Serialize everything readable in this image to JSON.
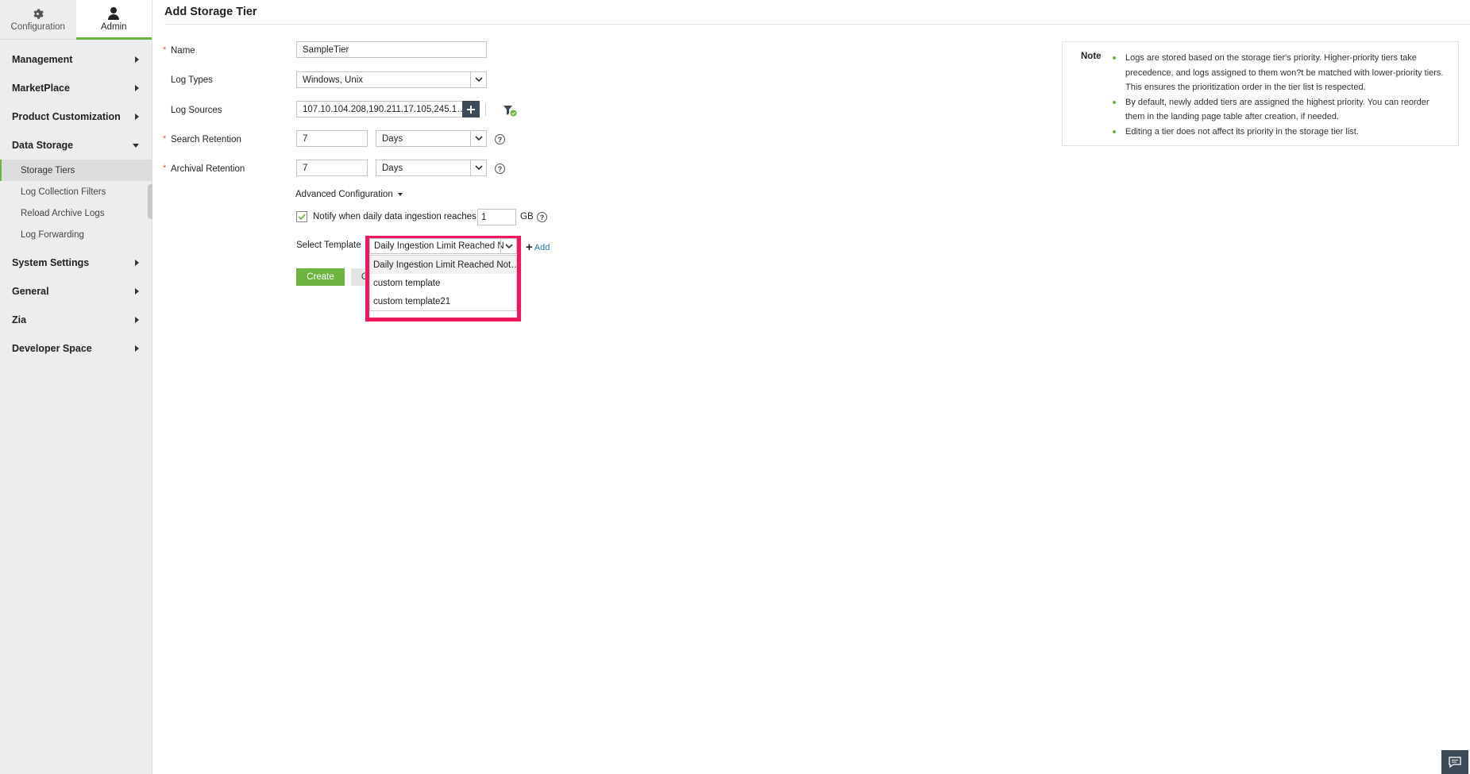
{
  "sidebar": {
    "tabs": [
      {
        "label": "Configuration",
        "icon": "gear-icon"
      },
      {
        "label": "Admin",
        "icon": "user-icon"
      }
    ],
    "menu": {
      "management": "Management",
      "marketplace": "MarketPlace",
      "product_customization": "Product Customization",
      "data_storage": "Data Storage",
      "system_settings": "System Settings",
      "general": "General",
      "zia": "Zia",
      "developer_space": "Developer Space"
    },
    "data_storage_items": {
      "storage_tiers": "Storage Tiers",
      "log_collection_filters": "Log Collection Filters",
      "reload_archive_logs": "Reload Archive Logs",
      "log_forwarding": "Log Forwarding"
    }
  },
  "page": {
    "title": "Add Storage Tier"
  },
  "form": {
    "required_mark": "*",
    "name_label": "Name",
    "name_value": "SampleTier",
    "log_types_label": "Log Types",
    "log_types_value": "Windows, Unix",
    "log_sources_label": "Log Sources",
    "log_sources_value": "107.10.104.208,190.211.17.105,245.1…",
    "search_retention_label": "Search Retention",
    "search_retention_value": "7",
    "search_retention_unit": "Days",
    "archival_retention_label": "Archival Retention",
    "archival_retention_value": "7",
    "archival_retention_unit": "Days",
    "advanced_config_label": "Advanced Configuration",
    "notify_label": "Notify when daily data ingestion reaches",
    "notify_value": "1",
    "notify_unit": "GB",
    "select_template_label": "Select Template",
    "select_template_value": "Daily Ingestion Limit Reached N",
    "add_link": "Add",
    "create_button": "Create",
    "cancel_button_partial": "C",
    "help_glyph": "?"
  },
  "dropdown": {
    "options": [
      "Daily Ingestion Limit Reached Not…",
      "custom template",
      "custom template21"
    ]
  },
  "note": {
    "title": "Note",
    "items": [
      "Logs are stored based on the storage tier's priority. Higher-priority tiers take precedence, and logs assigned to them won?t be matched with lower-priority tiers. This ensures the prioritization order in the tier list is respected.",
      "By default, newly added tiers are assigned the highest priority. You can reorder them in the landing page table after creation, if needed.",
      "Editing a tier does not affect its priority in the storage tier list."
    ]
  },
  "colors": {
    "accent_green": "#6db33f",
    "highlight_pink": "#f0185a",
    "dark_button": "#3d4a57",
    "link_blue": "#2b74b8"
  }
}
